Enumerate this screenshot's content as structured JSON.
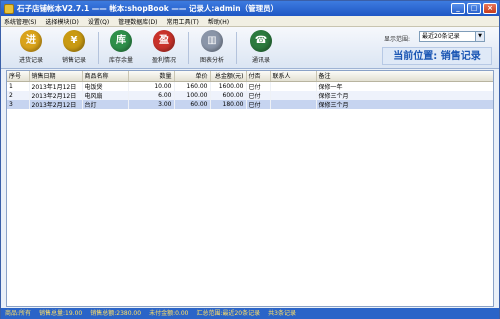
{
  "window": {
    "title": "石子店铺帐本V2.7.1 —— 帐本:shopBook —— 记录人:admin（管理员）",
    "controls": {
      "minimize": "_",
      "maximize": "□",
      "close": "×"
    }
  },
  "menu": [
    "系统管理(S)",
    "选择模块(D)",
    "设置(Q)",
    "管理数据库(D)",
    "常用工具(T)",
    "帮助(H)"
  ],
  "toolbar": {
    "buttons": [
      {
        "label": "进货记录",
        "glyph": "进",
        "color": "#d9a31b"
      },
      {
        "label": "销售记录",
        "glyph": "¥",
        "color": "#c99a12"
      },
      {
        "label": "库存余量",
        "glyph": "库",
        "color": "#2f8f4a"
      },
      {
        "label": "盈利情况",
        "glyph": "盈",
        "color": "#c8322a"
      },
      {
        "label": "图表分析",
        "glyph": "▥",
        "color": "#8a95a8"
      },
      {
        "label": "通讯录",
        "glyph": "☎",
        "color": "#2c7a3e"
      }
    ],
    "range_label": "显示范围:",
    "range_value": "最近20条记录",
    "location": "当前位置: 销售记录"
  },
  "table": {
    "headers": [
      "序号",
      "销售日期",
      "商品名称",
      "数量",
      "单价",
      "总金额(元)",
      "付否",
      "联系人",
      "备注"
    ],
    "rows": [
      [
        "1",
        "2013年1月12日",
        "电饭煲",
        "10.00",
        "160.00",
        "1600.00",
        "已付",
        "",
        "保修一年"
      ],
      [
        "2",
        "2013年2月12日",
        "电风扇",
        "6.00",
        "100.00",
        "600.00",
        "已付",
        "",
        "保修三个月"
      ],
      [
        "3",
        "2013年2月12日",
        "台灯",
        "3.00",
        "60.00",
        "180.00",
        "已付",
        "",
        "保修三个月"
      ]
    ]
  },
  "status": [
    "商品:所有",
    "销售总量:19.00",
    "销售总额:2380.00",
    "未付金额:0.00",
    "汇总范围:最近20条记录",
    "共3条记录"
  ]
}
